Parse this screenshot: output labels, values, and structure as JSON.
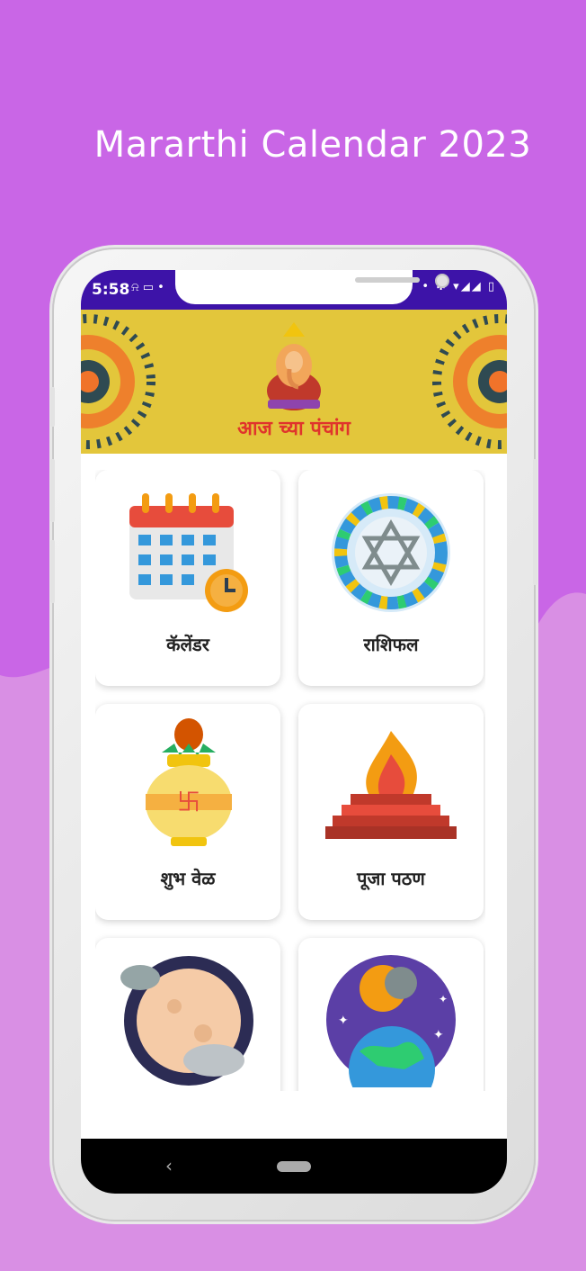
{
  "headline": "Mararthi Calendar 2023",
  "status": {
    "time": "5:58",
    "left_icons": "⍾ ▭ •",
    "right_icons": "• ✱ ▾◢◢ ▯"
  },
  "banner": {
    "title": "आज च्या पंचांग"
  },
  "cards": [
    {
      "label": "कॅलेंडर",
      "icon": "calendar-icon"
    },
    {
      "label": "राशिफल",
      "icon": "zodiac-wheel-icon"
    },
    {
      "label": "शुभ वेळ",
      "icon": "kalash-icon"
    },
    {
      "label": "पूजा पठण",
      "icon": "havan-fire-icon"
    },
    {
      "label": "",
      "icon": "moon-clouds-icon"
    },
    {
      "label": "",
      "icon": "eclipse-earth-icon"
    }
  ],
  "nav": {
    "back": "‹"
  },
  "colors": {
    "background": "#c966e6",
    "status_bar": "#3d13a8",
    "banner": "#e3c63b",
    "banner_text": "#e0342c"
  }
}
